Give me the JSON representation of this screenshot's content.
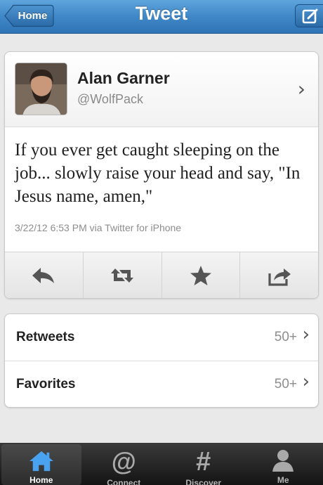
{
  "nav": {
    "back_label": "Home",
    "title": "Tweet",
    "compose_icon": "compose-icon"
  },
  "tweet": {
    "author_name": "Alan Garner",
    "author_handle": "@WolfPack",
    "text": "If you ever get caught sleeping on the job... slowly raise your head and say, \"In Jesus name, amen,\"",
    "meta": "3/22/12 6:53 PM via Twitter for iPhone",
    "actions": [
      {
        "icon": "reply-icon"
      },
      {
        "icon": "retweet-icon"
      },
      {
        "icon": "star-icon"
      },
      {
        "icon": "share-icon"
      }
    ]
  },
  "stats": {
    "retweets_label": "Retweets",
    "retweets_count": "50+",
    "favorites_label": "Favorites",
    "favorites_count": "50+"
  },
  "tabbar": {
    "tabs": [
      {
        "label": "Home",
        "icon": "home-icon",
        "active": true
      },
      {
        "label": "Connect",
        "icon": "at-icon",
        "active": false
      },
      {
        "label": "Discover",
        "icon": "hash-icon",
        "active": false
      },
      {
        "label": "Me",
        "icon": "person-icon",
        "active": false
      }
    ]
  },
  "colors": {
    "navbar": "#3f88c8",
    "active_tab_icon": "#4aa3f0"
  }
}
